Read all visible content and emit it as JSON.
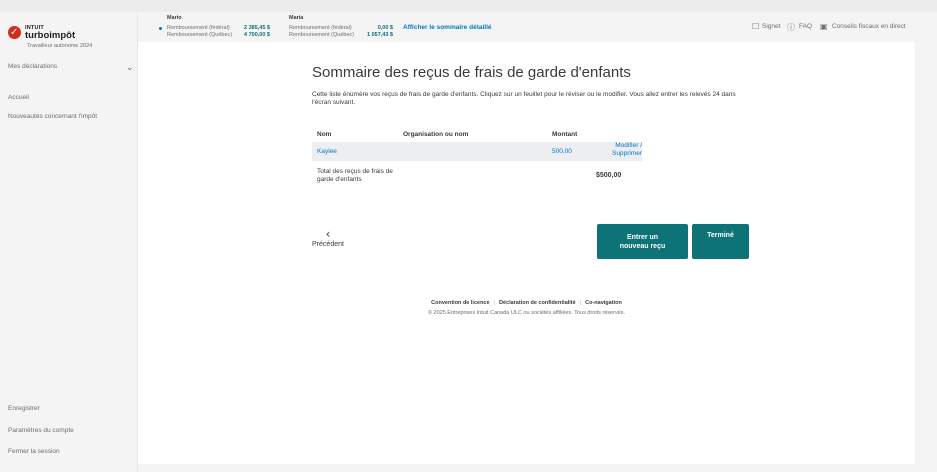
{
  "brand": {
    "intuit": "INTUIT",
    "product": "turboimpôt",
    "edition": "Travailleur autonome 2024"
  },
  "sidebar": {
    "my_returns": "Mes déclarations",
    "items": [
      "Accueil",
      "Nouveautés concernant l'impôt"
    ],
    "bottom_items": [
      "Enregistrer",
      "Paramètres du compte",
      "Fermer la session"
    ]
  },
  "refund_bar": {
    "person1": {
      "name": "Mario",
      "federal_label": "Remboursement (fédéral)",
      "federal_value": "2 385,45 $",
      "quebec_label": "Remboursement (Québec)",
      "quebec_value": "4 700,00 $"
    },
    "person2": {
      "name": "Maria",
      "federal_label": "Remboursement (fédéral)",
      "federal_value": "0,00 $",
      "quebec_label": "Remboursement (Québec)",
      "quebec_value": "1 057,43 $"
    },
    "summary_link": "Afficher le sommaire détaillé",
    "bookmark": "Signet",
    "faq": "FAQ",
    "advice": "Conseils fiscaux en direct"
  },
  "main": {
    "title": "Sommaire des reçus de frais de garde d'enfants",
    "intro": "Cette liste énumère vos reçus de frais de garde d'enfants. Cliquez sur un feuillet pour le réviser ou le modifier. Vous allez entrer les relevés 24 dans l'écran suivant.",
    "columns": [
      "Nom",
      "Organisation ou nom",
      "Montant"
    ],
    "rows": [
      {
        "name": "Kaylee",
        "organization": "",
        "amount": "500,00",
        "action": "Modifier / Supprimer"
      }
    ],
    "total_label": "Total des reçus de frais de garde d'enfants",
    "total_value": "$500,00",
    "previous": "Précédent",
    "new_receipt": "Entrer un nouveau reçu",
    "done": "Terminé"
  },
  "footer": {
    "license": "Convention de licence",
    "privacy": "Déclaration de confidentialité",
    "conavigation": "Co-navigation",
    "copyright": "© 2025 Entreprises Intuit Canada ULC ou sociétés affiliées. Tous droits réservés."
  },
  "colors": {
    "accent_teal": "#0d7377",
    "link_blue": "#0077c5",
    "brand_red": "#d52b1e"
  }
}
